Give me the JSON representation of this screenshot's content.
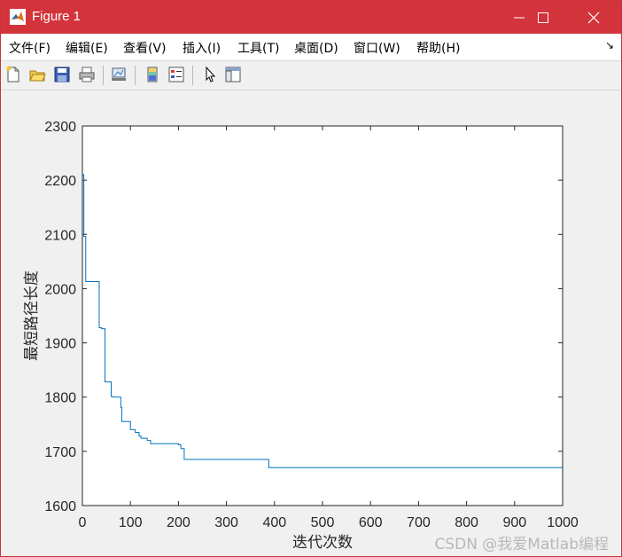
{
  "window": {
    "title": "Figure 1"
  },
  "menu": [
    {
      "label": "文件(F)"
    },
    {
      "label": "编辑(E)"
    },
    {
      "label": "查看(V)"
    },
    {
      "label": "插入(I)"
    },
    {
      "label": "工具(T)"
    },
    {
      "label": "桌面(D)"
    },
    {
      "label": "窗口(W)"
    },
    {
      "label": "帮助(H)"
    }
  ],
  "toolbar": [
    "new-figure",
    "open-file",
    "save",
    "print",
    "link-plot",
    "insert-colorbar",
    "insert-legend",
    "edit-plot-pointer",
    "property-inspector"
  ],
  "chart_data": {
    "type": "line",
    "xlabel": "迭代次数",
    "ylabel": "最短路径长度",
    "xlim": [
      0,
      1000
    ],
    "ylim": [
      1600,
      2300
    ],
    "xticks": [
      "0",
      "100",
      "200",
      "300",
      "400",
      "500",
      "600",
      "700",
      "800",
      "900",
      "1000"
    ],
    "yticks": [
      "1600",
      "1700",
      "1800",
      "1900",
      "2000",
      "2100",
      "2200",
      "2300"
    ],
    "grid": false,
    "line_color": "#0072bd",
    "series": [
      {
        "x": [
          0,
          3,
          3,
          7,
          7,
          35,
          35,
          40,
          40,
          47,
          47,
          60,
          60,
          65,
          65,
          80,
          80,
          82,
          82,
          100,
          100,
          110,
          110,
          118,
          118,
          122,
          122,
          135,
          135,
          142,
          142,
          200,
          200,
          205,
          205,
          212,
          212,
          388,
          388,
          1000
        ],
        "y": [
          2210,
          2210,
          2096,
          2096,
          2013,
          2013,
          1928,
          1928,
          1926,
          1926,
          1828,
          1828,
          1801,
          1801,
          1800,
          1800,
          1781,
          1781,
          1755,
          1755,
          1740,
          1740,
          1735,
          1735,
          1728,
          1728,
          1724,
          1724,
          1720,
          1720,
          1714,
          1714,
          1712,
          1712,
          1705,
          1705,
          1685,
          1685,
          1670,
          1670
        ]
      }
    ]
  },
  "watermark": "CSDN @我爱Matlab编程"
}
